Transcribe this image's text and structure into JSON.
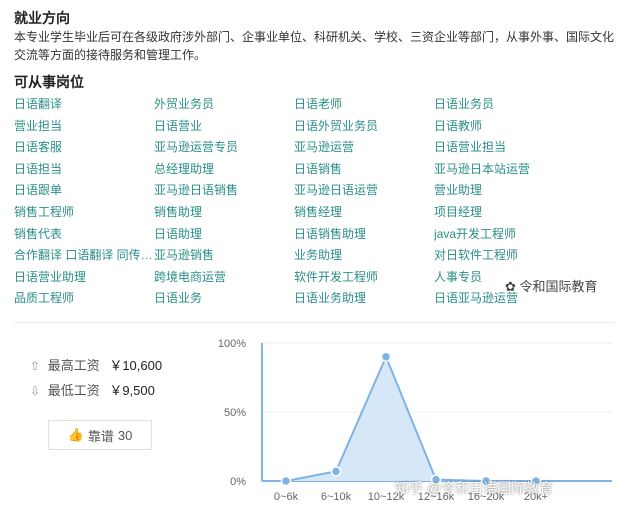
{
  "employment": {
    "title": "就业方向",
    "description": "本专业学生毕业后可在各级政府涉外部门、企事业单位、科研机关、学校、三资企业等部门，从事外事、国际文化交流等方面的接待服务和管理工作。"
  },
  "positions": {
    "title": "可从事岗位",
    "items": [
      "日语翻译",
      "外贸业务员",
      "日语老师",
      "日语业务员",
      "营业担当",
      "日语营业",
      "日语外贸业务员",
      "日语教师",
      "日语客服",
      "亚马逊运营专员",
      "亚马逊运营",
      "日语营业担当",
      "日语担当",
      "总经理助理",
      "日语销售",
      "亚马逊日本站运营",
      "日语跟单",
      "亚马逊日语销售",
      "亚马逊日语运营",
      "营业助理",
      "销售工程师",
      "销售助理",
      "销售经理",
      "项目经理",
      "销售代表",
      "日语助理",
      "日语销售助理",
      "java开发工程师",
      "合作翻译 口语翻译 同传…",
      "亚马逊销售",
      "业务助理",
      "对日软件工程师",
      "日语营业助理",
      "跨境电商运营",
      "软件开发工程师",
      "人事专员",
      "品质工程师",
      "日语业务",
      "日语业务助理",
      "日语亚马逊运营"
    ]
  },
  "salary": {
    "max_label": "最高工资",
    "max_value": "￥10,600",
    "min_label": "最低工资",
    "min_value": "￥9,500"
  },
  "like": {
    "label": "靠谱",
    "count": "30"
  },
  "chart_data": {
    "type": "area",
    "categories": [
      "0~6k",
      "6~10k",
      "10~12k",
      "12~16k",
      "16~20k",
      "20k+"
    ],
    "values": [
      0,
      7,
      90,
      1,
      0,
      0
    ],
    "ylim": [
      0,
      100
    ],
    "yticks": [
      "0%",
      "50%",
      "100%"
    ],
    "fill_color": "#d6e8f8",
    "line_color": "#7fb3e3"
  },
  "watermarks": {
    "brand": "令和国际教育",
    "zhihu": "知乎 @令和日语国际教育"
  },
  "colors": {
    "job_link": "#2a8f86",
    "like_icon": "#5aa73a"
  }
}
